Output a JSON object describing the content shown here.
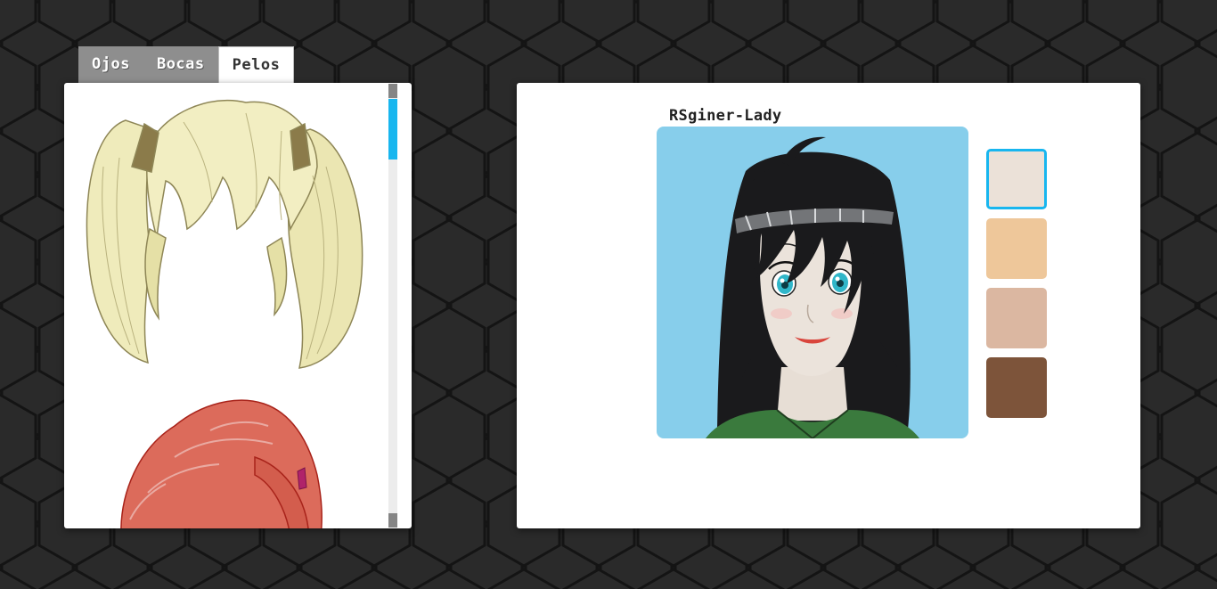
{
  "tabs": [
    {
      "label": "Ojos",
      "active": false
    },
    {
      "label": "Bocas",
      "active": false
    },
    {
      "label": "Pelos",
      "active": true
    }
  ],
  "hair_options": [
    {
      "name": "blonde-pigtails",
      "color": "#efebbb"
    },
    {
      "name": "red-ponytail",
      "color": "#dc6b5b"
    }
  ],
  "character": {
    "name": "RSginer-Lady",
    "hair_color": "#1a1a1c",
    "eye_color": "#30b6c9",
    "shirt_color": "#3a7a3d",
    "background_color": "#87ceeb"
  },
  "skin_tones": [
    {
      "name": "light",
      "color": "#ebe1d8",
      "selected": true
    },
    {
      "name": "peach",
      "color": "#eec79a",
      "selected": false
    },
    {
      "name": "tan",
      "color": "#dbb7a1",
      "selected": false
    },
    {
      "name": "brown",
      "color": "#7d543a",
      "selected": false
    }
  ],
  "colors": {
    "accent": "#18b6ef",
    "tab_bar": "#8e8e8e",
    "background": "#1f1f1f"
  }
}
